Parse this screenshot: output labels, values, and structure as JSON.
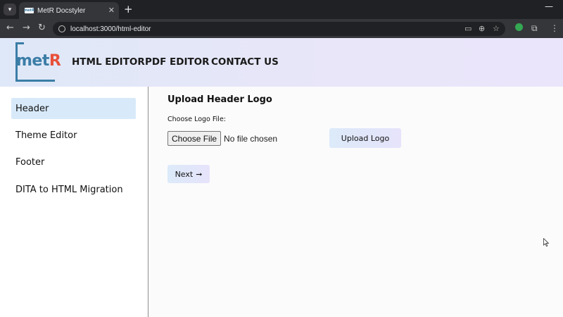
{
  "browser": {
    "tab_title": "MetR Docstyler",
    "favicon_text": "metR",
    "url": "localhost:3000/html-editor",
    "icons": {
      "tab_menu": "chevron-down-icon",
      "close": "close-icon",
      "new_tab": "plus-icon",
      "minimize": "minimize-icon",
      "back": "arrow-left-icon",
      "forward": "arrow-right-icon",
      "reload": "reload-icon",
      "site_info": "site-info-icon",
      "install": "install-app-icon",
      "zoom": "zoom-icon",
      "bookmark": "star-icon",
      "extension": "extension-icon",
      "sidebar": "side-panel-icon",
      "menu": "kebab-menu-icon"
    }
  },
  "app": {
    "logo": {
      "met": "met",
      "r": "R"
    },
    "colors": {
      "brand_blue": "#3b7da6",
      "brand_red": "#e8503a",
      "active_item": "#d8eafa"
    },
    "nav": [
      "HTML EDITOR",
      "PDF EDITOR",
      "CONTACT US"
    ]
  },
  "sidebar": {
    "items": [
      {
        "label": "Header",
        "active": true
      },
      {
        "label": "Theme Editor",
        "active": false
      },
      {
        "label": "Footer",
        "active": false
      },
      {
        "label": "DITA to HTML Migration",
        "active": false
      }
    ]
  },
  "main": {
    "title": "Upload Header Logo",
    "file_label": "Choose Logo File:",
    "file_button": "Choose File",
    "file_status": "No file chosen",
    "upload_button": "Upload Logo",
    "next_button": "Next",
    "next_arrow": "➞"
  }
}
